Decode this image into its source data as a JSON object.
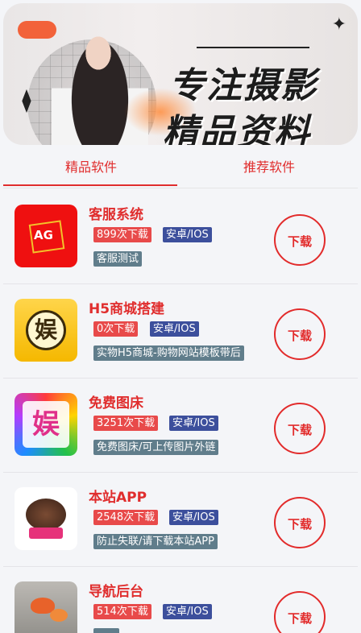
{
  "banner": {
    "title_line1": "专注摄影",
    "title_line2": "精品资料"
  },
  "tabs": [
    {
      "label": "精品软件",
      "active": true
    },
    {
      "label": "推荐软件",
      "active": false
    }
  ],
  "items": [
    {
      "name": "客服系统",
      "count": "899次下载",
      "platform": "安卓/IOS",
      "desc": "客服测试",
      "download": "下载",
      "icon": "ag-icon"
    },
    {
      "name": "H5商城搭建",
      "count": "0次下载",
      "platform": "安卓/IOS",
      "desc": "实物H5商城-购物网站模板带后",
      "download": "下载",
      "icon": "yu-coin-icon"
    },
    {
      "name": "免费图床",
      "count": "3251次下载",
      "platform": "安卓/IOS",
      "desc": "免费图床/可上传图片外链",
      "download": "下载",
      "icon": "colorful-yu-icon"
    },
    {
      "name": "本站APP",
      "count": "2548次下载",
      "platform": "安卓/IOS",
      "desc": "防止失联/请下载本站APP",
      "download": "下载",
      "icon": "roulette-icon"
    },
    {
      "name": "导航后台",
      "count": "514次下载",
      "platform": "安卓/IOS",
      "desc": "",
      "download": "下载",
      "icon": "tulip-icon"
    }
  ],
  "colors": {
    "accent": "#e02d2d",
    "count_badge": "#e84a4a",
    "platform_badge": "#3c4f9c",
    "desc_badge": "#607d8b"
  }
}
